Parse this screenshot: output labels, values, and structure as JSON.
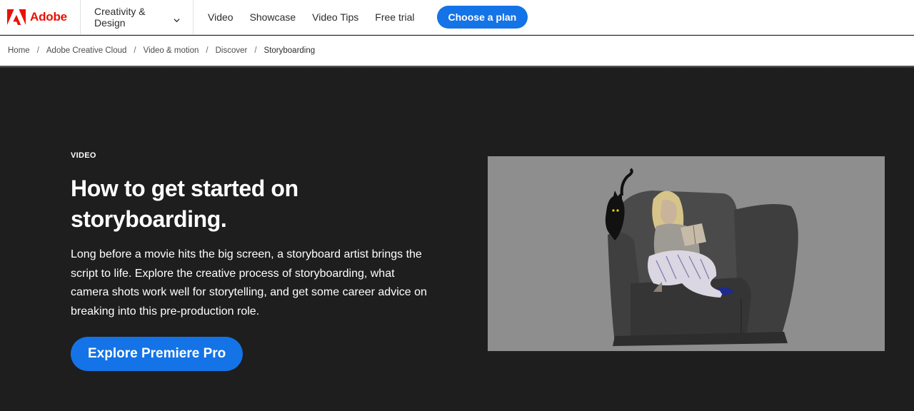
{
  "nav": {
    "brand": "Adobe",
    "dropdown_label": "Creativity & Design",
    "links": [
      "Video",
      "Showcase",
      "Video Tips",
      "Free trial"
    ],
    "cta_label": "Choose a plan"
  },
  "breadcrumb": {
    "items": [
      "Home",
      "Adobe Creative Cloud",
      "Video & motion",
      "Discover",
      "Storyboarding"
    ],
    "separator": "/"
  },
  "hero": {
    "eyebrow": "VIDEO",
    "title": "How to get started on storyboarding.",
    "body": "Long before a movie hits the big screen, a storyboard artist brings the script to life. Explore the creative process of storyboarding, what camera shots work well for storytelling, and get some career advice on breaking into this pre-production role.",
    "cta_label": "Explore Premiere Pro"
  },
  "colors": {
    "brand_red": "#eb1000",
    "accent_blue": "#1473e6",
    "hero_bg": "#1e1e1e"
  },
  "icons": {
    "logo": "adobe-logo-icon",
    "dropdown": "chevron-down-icon"
  }
}
